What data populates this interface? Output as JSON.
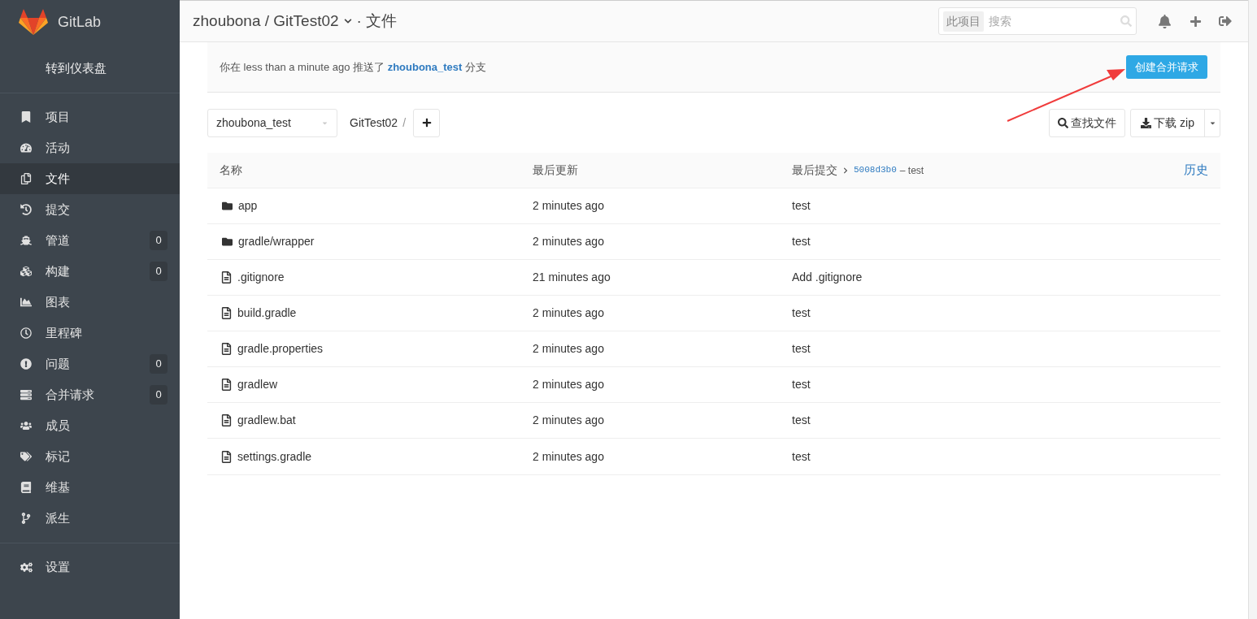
{
  "sidebar": {
    "logo_text": "GitLab",
    "dashboard_link": "转到仪表盘",
    "items": [
      {
        "label": "项目",
        "selected": false
      },
      {
        "label": "活动",
        "selected": false
      },
      {
        "label": "文件",
        "selected": true
      },
      {
        "label": "提交",
        "selected": false
      },
      {
        "label": "管道",
        "selected": false,
        "count": "0"
      },
      {
        "label": "构建",
        "selected": false,
        "count": "0"
      },
      {
        "label": "图表",
        "selected": false
      },
      {
        "label": "里程碑",
        "selected": false
      },
      {
        "label": "问题",
        "selected": false,
        "count": "0"
      },
      {
        "label": "合并请求",
        "selected": false,
        "count": "0"
      },
      {
        "label": "成员",
        "selected": false
      },
      {
        "label": "标记",
        "selected": false
      },
      {
        "label": "维基",
        "selected": false
      },
      {
        "label": "派生",
        "selected": false
      }
    ],
    "settings": "设置"
  },
  "header": {
    "breadcrumb": "zhoubona / GitTest02",
    "page": "· 文件",
    "search_scope": "此项目",
    "search_placeholder": "搜索"
  },
  "push_notice": {
    "text": "你在 less than a minute ago 推送了",
    "branch": "zhoubona_test",
    "suffix": "分支",
    "button": "创建合并请求"
  },
  "toolbar": {
    "branch": "zhoubona_test",
    "path": "GitTest02",
    "separator": "/",
    "find_button": "查找文件",
    "download_button": "下载 zip"
  },
  "table": {
    "columns": [
      "名称",
      "最后更新",
      "最后提交"
    ],
    "commit_sha": "5008d3b0",
    "commit_message": "– test",
    "history": "历史",
    "rows": [
      {
        "kind": "folder",
        "name": "app",
        "updated": "2 minutes ago",
        "commit": "test"
      },
      {
        "kind": "folder",
        "name": "gradle/wrapper",
        "updated": "2 minutes ago",
        "commit": "test"
      },
      {
        "kind": "file",
        "name": ".gitignore",
        "updated": "21 minutes ago",
        "commit": "Add .gitignore"
      },
      {
        "kind": "file",
        "name": "build.gradle",
        "updated": "2 minutes ago",
        "commit": "test"
      },
      {
        "kind": "file",
        "name": "gradle.properties",
        "updated": "2 minutes ago",
        "commit": "test"
      },
      {
        "kind": "file",
        "name": "gradlew",
        "updated": "2 minutes ago",
        "commit": "test"
      },
      {
        "kind": "file",
        "name": "gradlew.bat",
        "updated": "2 minutes ago",
        "commit": "test"
      },
      {
        "kind": "file",
        "name": "settings.gradle",
        "updated": "2 minutes ago",
        "commit": "test"
      }
    ]
  }
}
